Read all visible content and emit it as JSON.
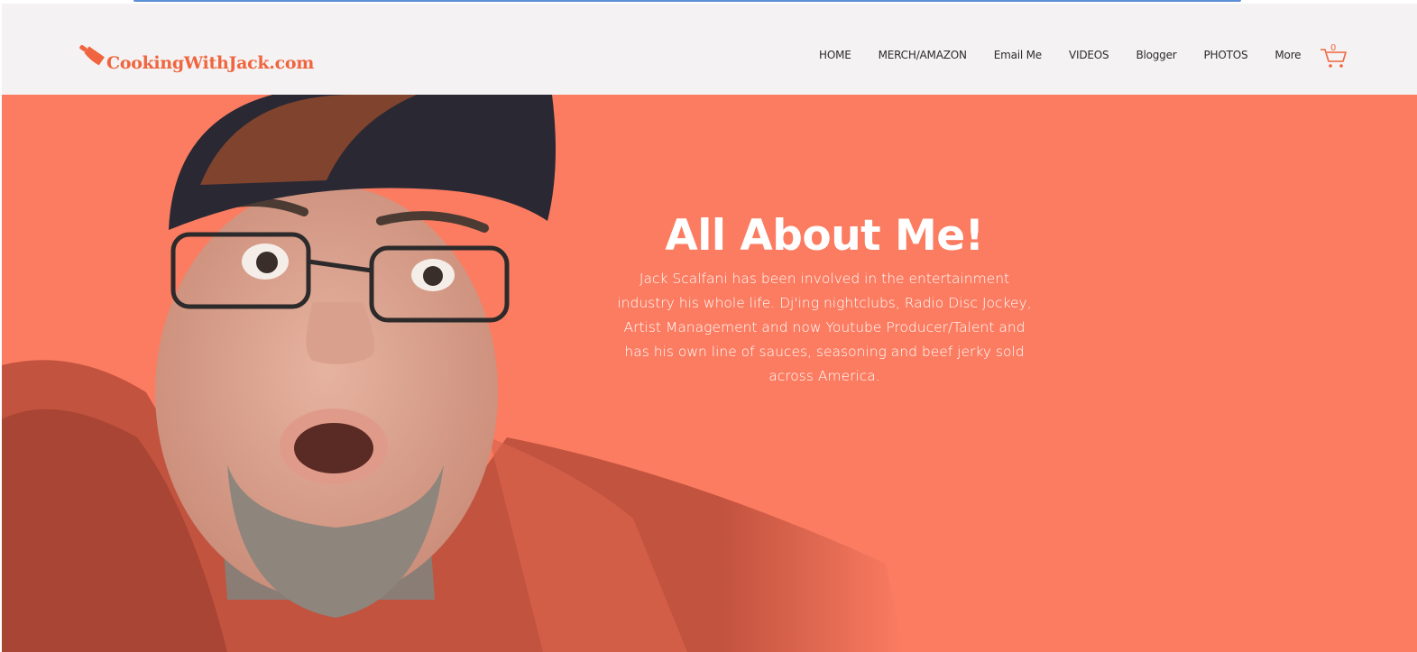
{
  "header": {
    "logo_text": "CookingWithJack.com",
    "logo_icon": "cleaver-icon"
  },
  "nav": {
    "items": [
      {
        "label": "HOME"
      },
      {
        "label": "MERCH/AMAZON"
      },
      {
        "label": "Email Me"
      },
      {
        "label": "VIDEOS"
      },
      {
        "label": "Blogger"
      },
      {
        "label": "PHOTOS"
      },
      {
        "label": "More"
      }
    ]
  },
  "cart": {
    "count": "0",
    "icon": "cart-icon"
  },
  "hero": {
    "title": "All About Me!",
    "body": "Jack Scalfani has been involved in the entertainment industry his whole life. Dj'ing nightclubs, Radio Disc Jockey, Artist Management and now Youtube Producer/Talent and has his own line of sauces, seasoning and beef jerky sold across America."
  },
  "colors": {
    "accent": "#f0653f",
    "hero_bg": "#fb7c61",
    "header_bg": "#f4f2f2"
  }
}
